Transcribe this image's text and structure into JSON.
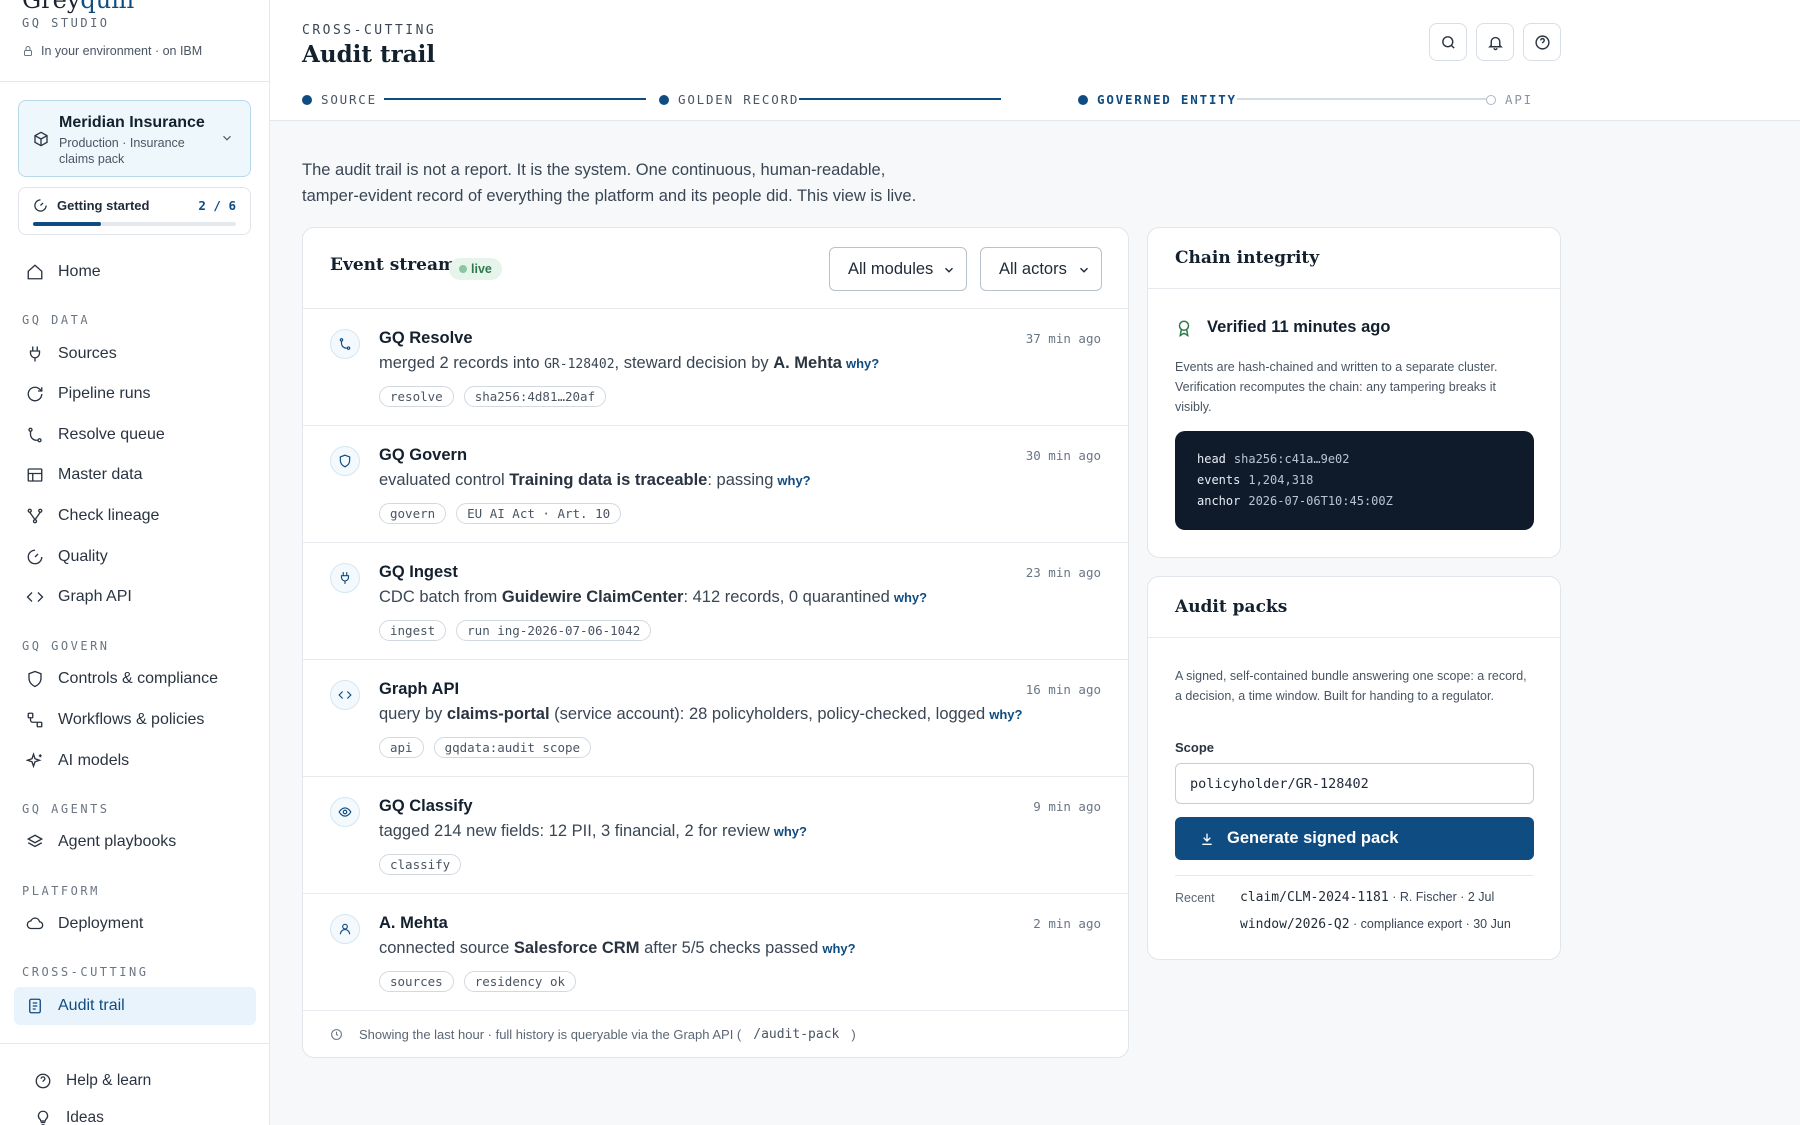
{
  "brand": {
    "logo_start": "Grey",
    "logo_end": "quill",
    "studio": "GQ STUDIO",
    "environment": "In your environment · on IBM"
  },
  "workspace": {
    "name": "Meridian Insurance",
    "subtitle": "Production · Insurance claims pack"
  },
  "getting_started": {
    "label": "Getting started",
    "count": "2 / 6",
    "progress": 0.333
  },
  "nav": {
    "home": "Home",
    "sections": {
      "data": "GQ DATA",
      "govern": "GQ GOVERN",
      "agents": "GQ AGENTS",
      "platform": "PLATFORM",
      "cross": "CROSS-CUTTING"
    },
    "items": {
      "sources": "Sources",
      "pipeline_runs": "Pipeline runs",
      "resolve_queue": "Resolve queue",
      "master_data": "Master data",
      "check_lineage": "Check lineage",
      "quality": "Quality",
      "graph_api": "Graph API",
      "controls": "Controls & compliance",
      "workflows": "Workflows & policies",
      "ai_models": "AI models",
      "agent_playbooks": "Agent playbooks",
      "deployment": "Deployment",
      "audit_trail": "Audit trail",
      "help": "Help & learn",
      "ideas": "Ideas"
    }
  },
  "header": {
    "eyebrow": "CROSS-CUTTING",
    "title": "Audit trail",
    "steps": [
      "SOURCE",
      "GOLDEN RECORD",
      "GOVERNED ENTITY",
      "API"
    ]
  },
  "intro": {
    "line1": "The audit trail is not a report. It is the system. One continuous, human-readable,",
    "line2": "tamper-evident record of everything the platform and its people did. This view is live."
  },
  "events": {
    "title": "Event stream",
    "live": "live",
    "filter_modules": "All modules",
    "filter_actors": "All actors",
    "why": "why?",
    "rows": [
      {
        "actor": "GQ Resolve",
        "time": "37 min ago",
        "t1": "merged 2 records into ",
        "code": "GR-128402",
        "t2": ", steward decision by ",
        "bold": "A. Mehta",
        "t3": "",
        "tags": [
          "resolve",
          "sha256:4d81…20af"
        ]
      },
      {
        "actor": "GQ Govern",
        "time": "30 min ago",
        "t1": "evaluated control ",
        "code": "",
        "t2": "",
        "bold": "Training data is traceable",
        "t3": ": passing",
        "tags": [
          "govern",
          "EU AI Act · Art. 10"
        ]
      },
      {
        "actor": "GQ Ingest",
        "time": "23 min ago",
        "t1": "CDC batch from ",
        "code": "",
        "t2": "",
        "bold": "Guidewire ClaimCenter",
        "t3": ": 412 records, 0 quarantined",
        "tags": [
          "ingest",
          "run ing-2026-07-06-1042"
        ]
      },
      {
        "actor": "Graph API",
        "time": "16 min ago",
        "t1": "query by ",
        "code": "",
        "t2": "",
        "bold": "claims-portal",
        "t3": " (service account): 28 policyholders, policy-checked, logged",
        "tags": [
          "api",
          "gqdata:audit scope"
        ]
      },
      {
        "actor": "GQ Classify",
        "time": "9 min ago",
        "t1": "tagged 214 new fields: 12 PII, 3 financial, 2 for review",
        "code": "",
        "t2": "",
        "bold": "",
        "t3": "",
        "tags": [
          "classify"
        ]
      },
      {
        "actor": "A. Mehta",
        "time": "2 min ago",
        "t1": "connected source ",
        "code": "",
        "t2": "",
        "bold": "Salesforce CRM",
        "t3": " after 5/5 checks passed",
        "tags": [
          "sources",
          "residency ok"
        ]
      }
    ],
    "footer_text": "Showing the last hour · full history is queryable via the Graph API (",
    "footer_code": "/audit-pack",
    "footer_end": ")"
  },
  "chain": {
    "title": "Chain integrity",
    "verified": "Verified 11 minutes ago",
    "description": "Events are hash-chained and written to a separate cluster. Verification recomputes the chain: any tampering breaks it visibly.",
    "head_key": "head",
    "head_val": "sha256:c41a…9e02",
    "events_key": "events",
    "events_val": "1,204,318",
    "anchor_key": "anchor",
    "anchor_val": "2026-07-06T10:45:00Z"
  },
  "packs": {
    "title": "Audit packs",
    "description": "A signed, self-contained bundle answering one scope: a record, a decision, a time window. Built for handing to a regulator.",
    "scope_label": "Scope",
    "scope_value": "policyholder/GR-128402",
    "button": "Generate signed pack",
    "recent_label": "Recent",
    "recent": [
      {
        "code": "claim/CLM-2024-1181",
        "meta": " · R. Fischer · 2 Jul"
      },
      {
        "code": "window/2026-Q2",
        "meta": " · compliance export · 30 Jun"
      }
    ]
  },
  "colors": {
    "accent": "#0f4c81",
    "live_green": "#2f7a4d",
    "code_bg": "#0f1b2b"
  },
  "icons": [
    "lock-icon",
    "cube-icon",
    "chevron-down-icon",
    "gauge-icon",
    "home-icon",
    "plug-icon",
    "refresh-icon",
    "branch-icon",
    "table-icon",
    "lineage-icon",
    "code-icon",
    "shield-icon",
    "workflow-icon",
    "sparkle-icon",
    "layers-icon",
    "cloud-icon",
    "document-icon",
    "help-icon",
    "lightbulb-icon",
    "search-icon",
    "bell-icon",
    "eye-icon",
    "user-icon",
    "clock-icon",
    "award-icon",
    "download-icon"
  ]
}
